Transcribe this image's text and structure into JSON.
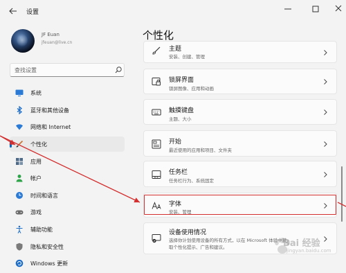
{
  "app": {
    "title": "设置"
  },
  "user": {
    "name": "JF Euan",
    "email": "jfeuan@live.cn"
  },
  "search": {
    "placeholder": "查找设置"
  },
  "sidebar": {
    "items": [
      {
        "label": "系统",
        "icon": "monitor-icon"
      },
      {
        "label": "蓝牙和其他设备",
        "icon": "bluetooth-icon"
      },
      {
        "label": "网络和 Internet",
        "icon": "wifi-icon"
      },
      {
        "label": "个性化",
        "icon": "brush-icon",
        "active": true
      },
      {
        "label": "应用",
        "icon": "apps-icon"
      },
      {
        "label": "帐户",
        "icon": "account-icon"
      },
      {
        "label": "时间和语言",
        "icon": "globe-clock-icon"
      },
      {
        "label": "游戏",
        "icon": "gamepad-icon"
      },
      {
        "label": "辅助功能",
        "icon": "accessibility-icon"
      },
      {
        "label": "隐私和安全性",
        "icon": "shield-icon"
      },
      {
        "label": "Windows 更新",
        "icon": "update-icon"
      }
    ]
  },
  "main": {
    "title": "个性化",
    "cards": [
      {
        "title": "主题",
        "subtitle": "安装、创建、管理",
        "icon": "brush-icon"
      },
      {
        "title": "锁屏界面",
        "subtitle": "锁屏图像、应用和动画",
        "icon": "lock-screen-icon"
      },
      {
        "title": "触摸键盘",
        "subtitle": "主题、大小",
        "icon": "keyboard-icon"
      },
      {
        "title": "开始",
        "subtitle": "最近使用的应用和项目、文件夹",
        "icon": "start-icon"
      },
      {
        "title": "任务栏",
        "subtitle": "任务栏行为、系统固定",
        "icon": "taskbar-icon"
      },
      {
        "title": "字体",
        "subtitle": "安装、管理",
        "icon": "font-icon",
        "highlighted": true
      },
      {
        "title": "设备使用情况",
        "subtitle": "选择你计划使用设备的所有方式，以在 Microsoft 体验中获",
        "subtitle2": "取个性化提示、广告和建议。",
        "icon": "device-usage-icon"
      }
    ]
  },
  "annotation": {
    "color": "#d32f2f"
  },
  "watermark": {
    "text": "Bai 经验",
    "sub": "jingyan.baidu.com"
  },
  "colors": {
    "accent": "#0067c0",
    "window_bg": "#f3f3f3",
    "card_bg": "#fbfbfb"
  }
}
